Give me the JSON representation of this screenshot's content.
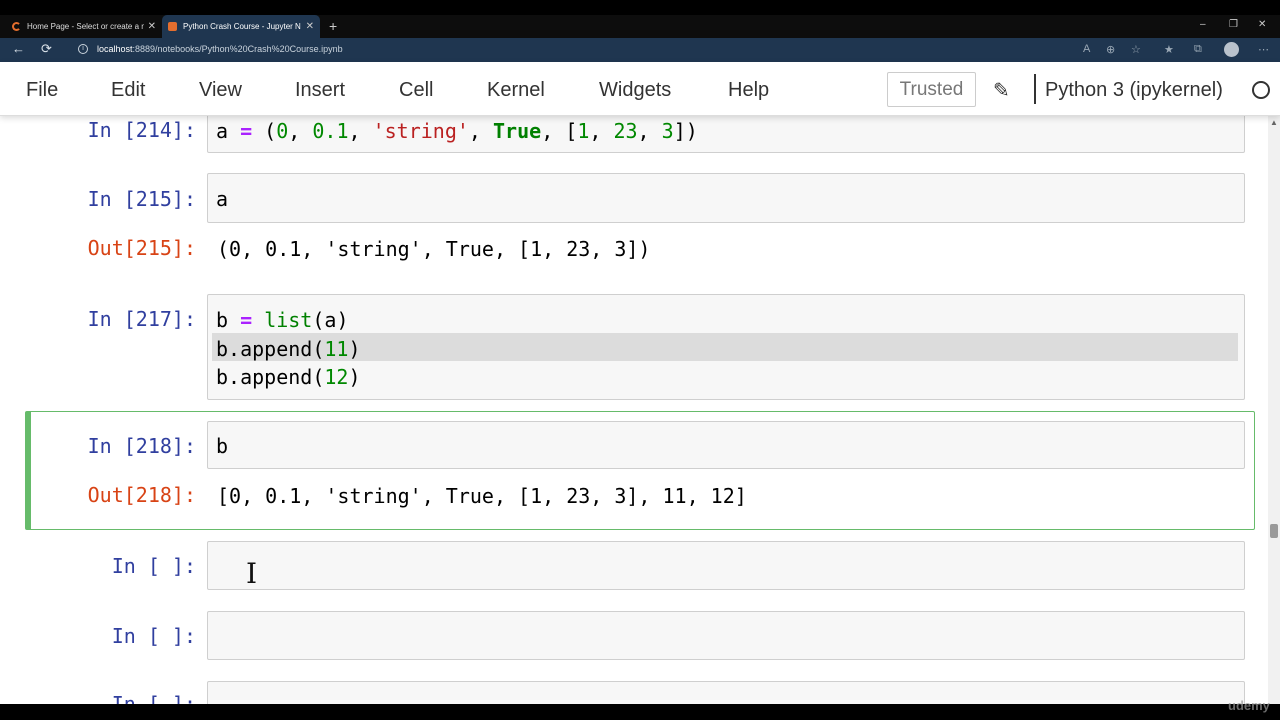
{
  "browser": {
    "tabs": [
      {
        "title": "Home Page - Select or create a n",
        "close": "✕"
      },
      {
        "title": "Python Crash Course - Jupyter N",
        "close": "✕"
      }
    ],
    "new_tab": "+",
    "window_controls": {
      "minimize": "–",
      "restore": "❐",
      "close": "✕"
    },
    "url_host": "localhost",
    "url_path": ":8889/notebooks/Python%20Crash%20Course.ipynb"
  },
  "menubar": {
    "items": [
      "File",
      "Edit",
      "View",
      "Insert",
      "Cell",
      "Kernel",
      "Widgets",
      "Help"
    ],
    "trusted": "Trusted",
    "kernel": "Python 3 (ipykernel)"
  },
  "cells": [
    {
      "in_prompt": "In [214]:"
    },
    {
      "in_prompt": "In [215]:",
      "code": "a",
      "out_prompt": "Out[215]:",
      "output": "(0, 0.1, 'string', True, [1, 23, 3])"
    },
    {
      "in_prompt": "In [217]:",
      "lines": [
        "b = list(a)",
        "b.append(11)",
        "b.append(12)"
      ]
    },
    {
      "in_prompt": "In [218]:",
      "code": "b",
      "out_prompt": "Out[218]:",
      "output": "[0, 0.1, 'string', True, [1, 23, 3], 11, 12]"
    },
    {
      "in_prompt": "In [ ]:"
    },
    {
      "in_prompt": "In [ ]:"
    },
    {
      "in_prompt": "In [ ]:"
    }
  ],
  "watermark": "udemy"
}
